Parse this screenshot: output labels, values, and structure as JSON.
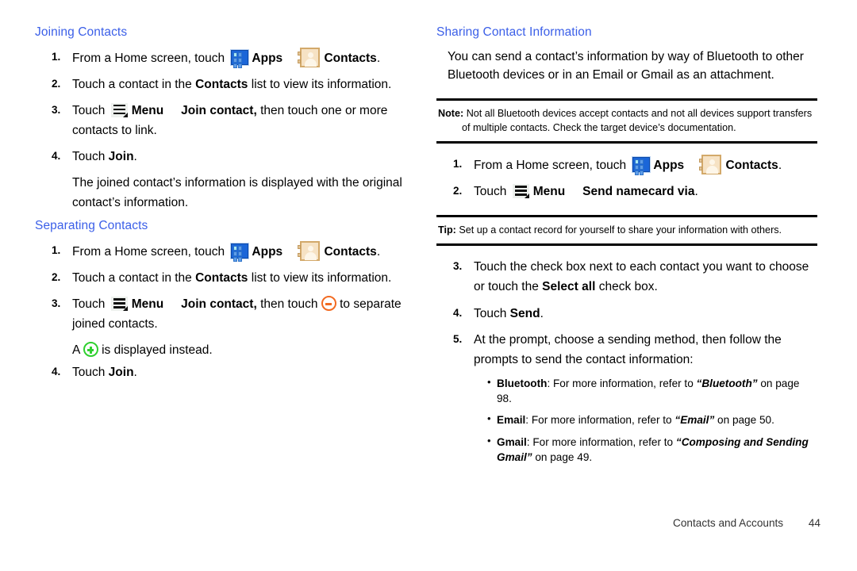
{
  "document": {
    "footer_title": "Contacts and Accounts",
    "footer_page": "44",
    "heading_color": "#3b5fe8",
    "rule_color": "#000000"
  },
  "left_column": {
    "sections": [
      {
        "heading": "Joining Contacts",
        "steps": [
          {
            "num": "1.",
            "pre": "From a Home screen, touch",
            "icon1": "apps-icon",
            "label1": "Apps",
            "icon2": "contacts-icon",
            "label2": "Contacts",
            "post": "."
          },
          {
            "num": "2.",
            "text_a": "Touch a contact in the ",
            "bold_a": "Contacts",
            "text_b": " list to view its information."
          },
          {
            "num": "3.",
            "pre": "Touch",
            "icon": "menu-icon",
            "label_menu": "Menu",
            "bold_cmd": "Join contact,",
            "post": "then touch one or more contacts to link."
          },
          {
            "num": "4.",
            "pre": "Touch ",
            "bold_cmd": "Join",
            "post": "."
          }
        ],
        "trailing_note": "The joined contact’s information is displayed with the original contact’s information."
      },
      {
        "heading": "Separating Contacts",
        "steps": [
          {
            "num": "1.",
            "pre": "From a Home screen, touch",
            "icon1": "apps-icon",
            "label1": "Apps",
            "icon2": "contacts-icon",
            "label2": "Contacts",
            "post": "."
          },
          {
            "num": "2.",
            "text_a": "Touch a contact in the ",
            "bold_a": "Contacts",
            "text_b": " list to view its information."
          },
          {
            "num": "3.",
            "pre": "Touch",
            "icon": "menu-icon",
            "label_menu": "Menu",
            "bold_cmd": "Join contact,",
            "mid": "then touch",
            "icon_minus": "minus-circle-icon",
            "post": "to separate joined contacts."
          },
          {
            "num": "4.",
            "pre": "Touch ",
            "bold_cmd": "Join",
            "post": "."
          }
        ],
        "inline_note_pre": "A",
        "inline_note_icon": "plus-circle-icon",
        "inline_note_post": "is displayed instead."
      }
    ]
  },
  "right_column": {
    "heading": "Sharing Contact Information",
    "intro": "You can send a contact’s information by way of Bluetooth to other Bluetooth devices or in an Email or Gmail as an attachment.",
    "note": {
      "label": "Note:",
      "text": "Not all Bluetooth devices accept contacts and not all devices support transfers of multiple contacts. Check the target device’s documentation."
    },
    "steps_top": [
      {
        "num": "1.",
        "pre": "From a Home screen, touch",
        "icon1": "apps-icon",
        "label1": "Apps",
        "icon2": "contacts-icon",
        "label2": "Contacts",
        "post": "."
      },
      {
        "num": "2.",
        "pre": "Touch",
        "icon": "menu-icon",
        "label_menu": "Menu",
        "bold_cmd": "Send namecard via",
        "post": "."
      }
    ],
    "tip": {
      "label": "Tip:",
      "text": "Set up a contact record for yourself to share your information with others."
    },
    "steps_bottom": [
      {
        "num": "3.",
        "text_a": "Touch the check box next to each contact you want to choose or touch the ",
        "bold_a": "Select all",
        "text_b": " check box."
      },
      {
        "num": "4.",
        "text_a": "Touch ",
        "bold_a": "Send",
        "text_b": "."
      },
      {
        "num": "5.",
        "text_a": "At the prompt, choose a sending method, then follow the prompts to send the contact information:",
        "bold_a": "",
        "text_b": ""
      }
    ],
    "bullets": [
      {
        "bullet": "•",
        "term": "Bluetooth",
        "mid": ": For more information, refer to ",
        "ref": "“Bluetooth”",
        "tail": " on page 98."
      },
      {
        "bullet": "•",
        "term": "Email",
        "mid": ": For more information, refer to ",
        "ref": "“Email”",
        "tail": " on page 50."
      },
      {
        "bullet": "•",
        "term": "Gmail",
        "mid": ": For more information, refer to ",
        "ref": "“Composing and Sending Gmail”",
        "tail": " on page 49."
      }
    ]
  }
}
